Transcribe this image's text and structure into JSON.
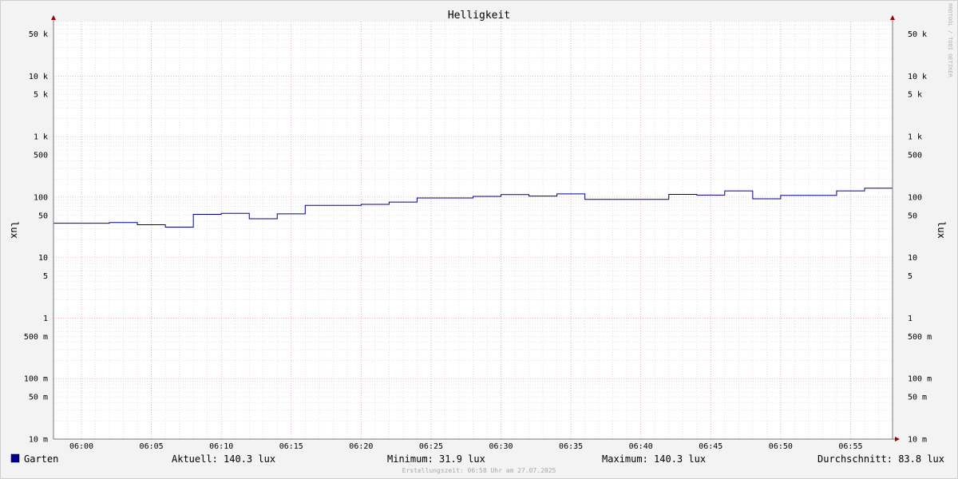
{
  "chart_data": {
    "type": "line",
    "title": "Helligkeit",
    "ylabel_left": "lux",
    "ylabel_right": "lux",
    "yscale": "log",
    "ylim": [
      0.01,
      80000
    ],
    "xlim": [
      "05:58",
      "06:58"
    ],
    "grid": true,
    "x_ticks": [
      "06:00",
      "06:05",
      "06:10",
      "06:15",
      "06:20",
      "06:25",
      "06:30",
      "06:35",
      "06:40",
      "06:45",
      "06:50",
      "06:55"
    ],
    "y_ticks": [
      {
        "value": 50000,
        "label": "50 k"
      },
      {
        "value": 10000,
        "label": "10 k"
      },
      {
        "value": 5000,
        "label": "5 k"
      },
      {
        "value": 1000,
        "label": "1 k"
      },
      {
        "value": 500,
        "label": "500"
      },
      {
        "value": 100,
        "label": "100"
      },
      {
        "value": 50,
        "label": "50"
      },
      {
        "value": 10,
        "label": "10"
      },
      {
        "value": 5,
        "label": "5"
      },
      {
        "value": 1,
        "label": "1"
      },
      {
        "value": 0.5,
        "label": "500 m"
      },
      {
        "value": 0.1,
        "label": "100 m"
      },
      {
        "value": 0.05,
        "label": "50 m"
      },
      {
        "value": 0.01,
        "label": "10 m"
      }
    ],
    "series": [
      {
        "name": "Garten",
        "color": "#000090",
        "step": true,
        "x": [
          "05:58",
          "06:02",
          "06:04",
          "06:06",
          "06:08",
          "06:10",
          "06:12",
          "06:14",
          "06:16",
          "06:18",
          "06:20",
          "06:22",
          "06:24",
          "06:26",
          "06:28",
          "06:30",
          "06:32",
          "06:34",
          "06:36",
          "06:38",
          "06:40",
          "06:42",
          "06:44",
          "06:46",
          "06:48",
          "06:50",
          "06:52",
          "06:54",
          "06:56",
          "06:58"
        ],
        "values": [
          37,
          38,
          35,
          31.9,
          52,
          54,
          44,
          53,
          73,
          73,
          76,
          83,
          97,
          97,
          103,
          110,
          104,
          113,
          92,
          92,
          92,
          111,
          108,
          127,
          94,
          107,
          107,
          127,
          140.3,
          140.3
        ]
      }
    ]
  },
  "legend": {
    "series_name": "Garten",
    "swatch_color": "#000090",
    "current": "Aktuell: 140.3 lux",
    "minimum": "Minimum:  31.9 lux",
    "maximum": "Maximum: 140.3 lux",
    "average": "Durchschnitt:  83.8 lux"
  },
  "watermark": "RRDTOOL / TOBI OETIKER",
  "footer": "Erstellungszeit: 06:58 Uhr am 27.07.2025"
}
